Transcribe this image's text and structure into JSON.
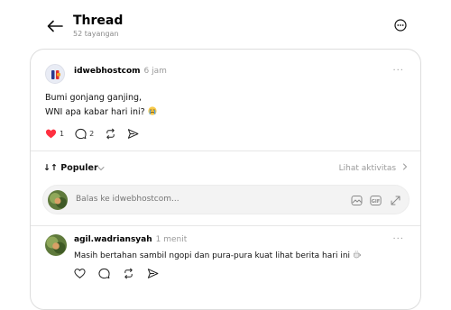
{
  "header": {
    "title": "Thread",
    "subtitle": "52 tayangan"
  },
  "post": {
    "username": "idwebhostcom",
    "time": "6 jam",
    "line1": "Bumi gonjang ganjing,",
    "line2": "WNI apa kabar hari ini?",
    "likes": "1",
    "replies": "2",
    "more": "···"
  },
  "sort": {
    "label": "↓↑ Populer",
    "activity": "Lihat aktivitas"
  },
  "reply_box": {
    "placeholder": "Balas ke idwebhostcom..."
  },
  "comment": {
    "username": "agil.wadriansyah",
    "time": "1 menit",
    "text": "Masih bertahan sambil ngopi dan pura-pura kuat lihat berita hari ini",
    "more": "···"
  },
  "colors": {
    "like_red": "#ff3040",
    "muted": "#9a9a9a",
    "border": "#dddddd"
  },
  "icons": [
    "back-arrow-icon",
    "more-circle-icon",
    "heart-icon",
    "comment-icon",
    "repost-icon",
    "share-icon",
    "chevron-down-icon",
    "chevron-right-icon",
    "sticker-icon",
    "gif-icon",
    "expand-icon",
    "coffee-emoji",
    "crying-emoji"
  ]
}
